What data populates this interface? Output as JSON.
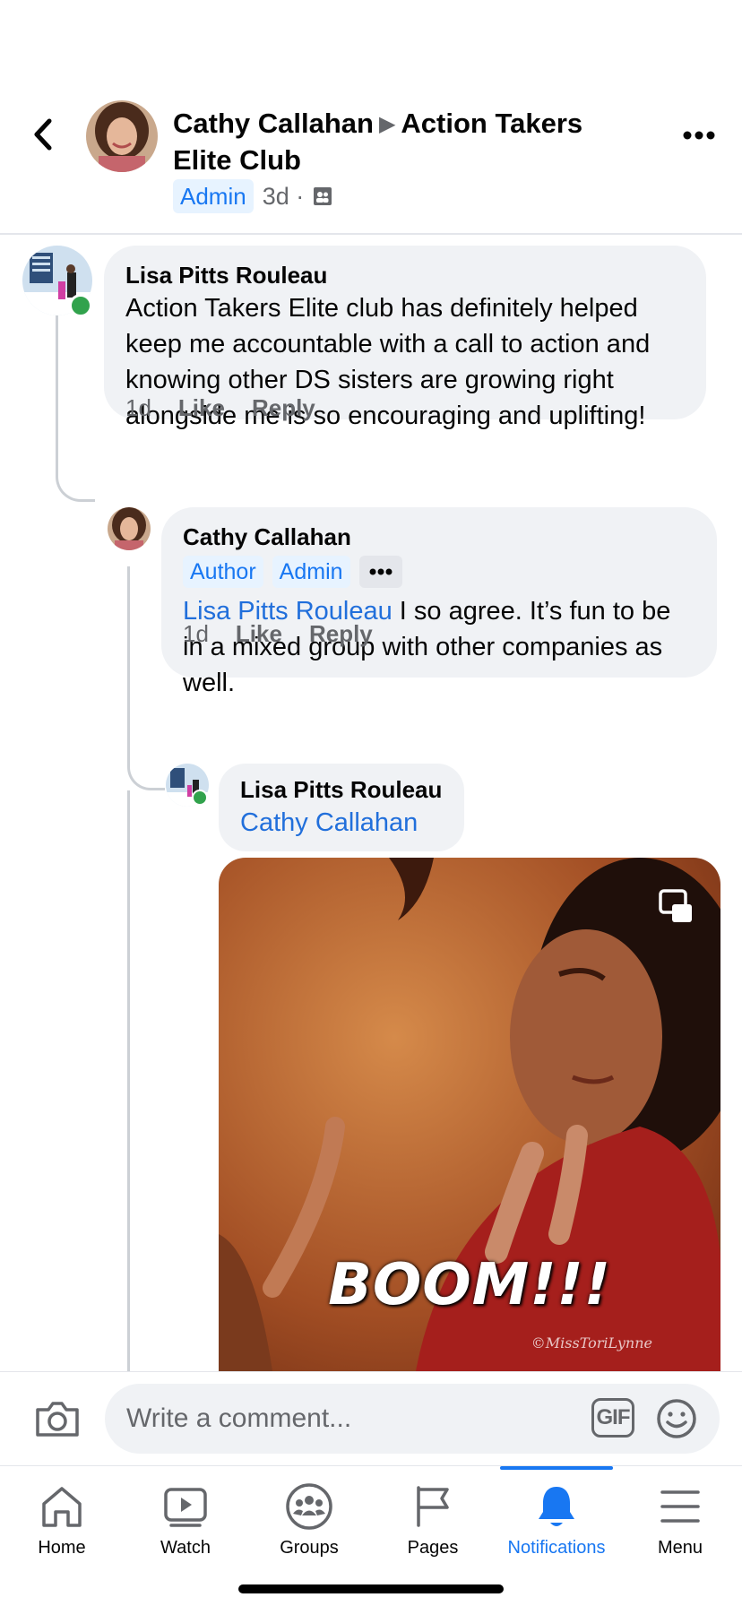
{
  "post": {
    "author": "Cathy Callahan",
    "group": "Action Takers Elite Club",
    "badge": "Admin",
    "time": "3d ·",
    "icons": {
      "back": "chevron-left-icon",
      "more": "more-horizontal-icon",
      "audience": "group-audience-icon"
    }
  },
  "comments": [
    {
      "name": "Lisa Pitts Rouleau",
      "text": "Action Takers Elite club has definitely helped keep me accountable with a call to action and knowing other DS sisters are growing right alongside me is so encouraging and uplifting!",
      "time": "1d",
      "like": "Like",
      "reply": "Reply"
    },
    {
      "name": "Cathy Callahan",
      "badges": [
        "Author",
        "Admin"
      ],
      "mention": "Lisa Pitts Rouleau",
      "text": " I so agree. It’s fun to be in a mixed group with other companies as well.",
      "time": "1d",
      "like": "Like",
      "reply": "Reply"
    },
    {
      "name": "Lisa Pitts Rouleau",
      "mention": "Cathy Callahan",
      "gif_caption": "BOOM!!!",
      "gif_watermark": "©MissToriLynne"
    }
  ],
  "composer": {
    "placeholder": "Write a comment...",
    "gif_label": "GIF",
    "icons": {
      "camera": "camera-icon",
      "emoji": "emoji-icon"
    }
  },
  "tabs": [
    {
      "label": "Home",
      "icon": "home-icon",
      "active": false
    },
    {
      "label": "Watch",
      "icon": "watch-icon",
      "active": false
    },
    {
      "label": "Groups",
      "icon": "groups-icon",
      "active": false
    },
    {
      "label": "Pages",
      "icon": "pages-flag-icon",
      "active": false
    },
    {
      "label": "Notifications",
      "icon": "bell-icon",
      "active": true
    },
    {
      "label": "Menu",
      "icon": "menu-icon",
      "active": false
    }
  ],
  "colors": {
    "accent": "#1877f2",
    "bubble": "#f0f2f5",
    "muted": "#65676b",
    "online": "#31a24c"
  }
}
